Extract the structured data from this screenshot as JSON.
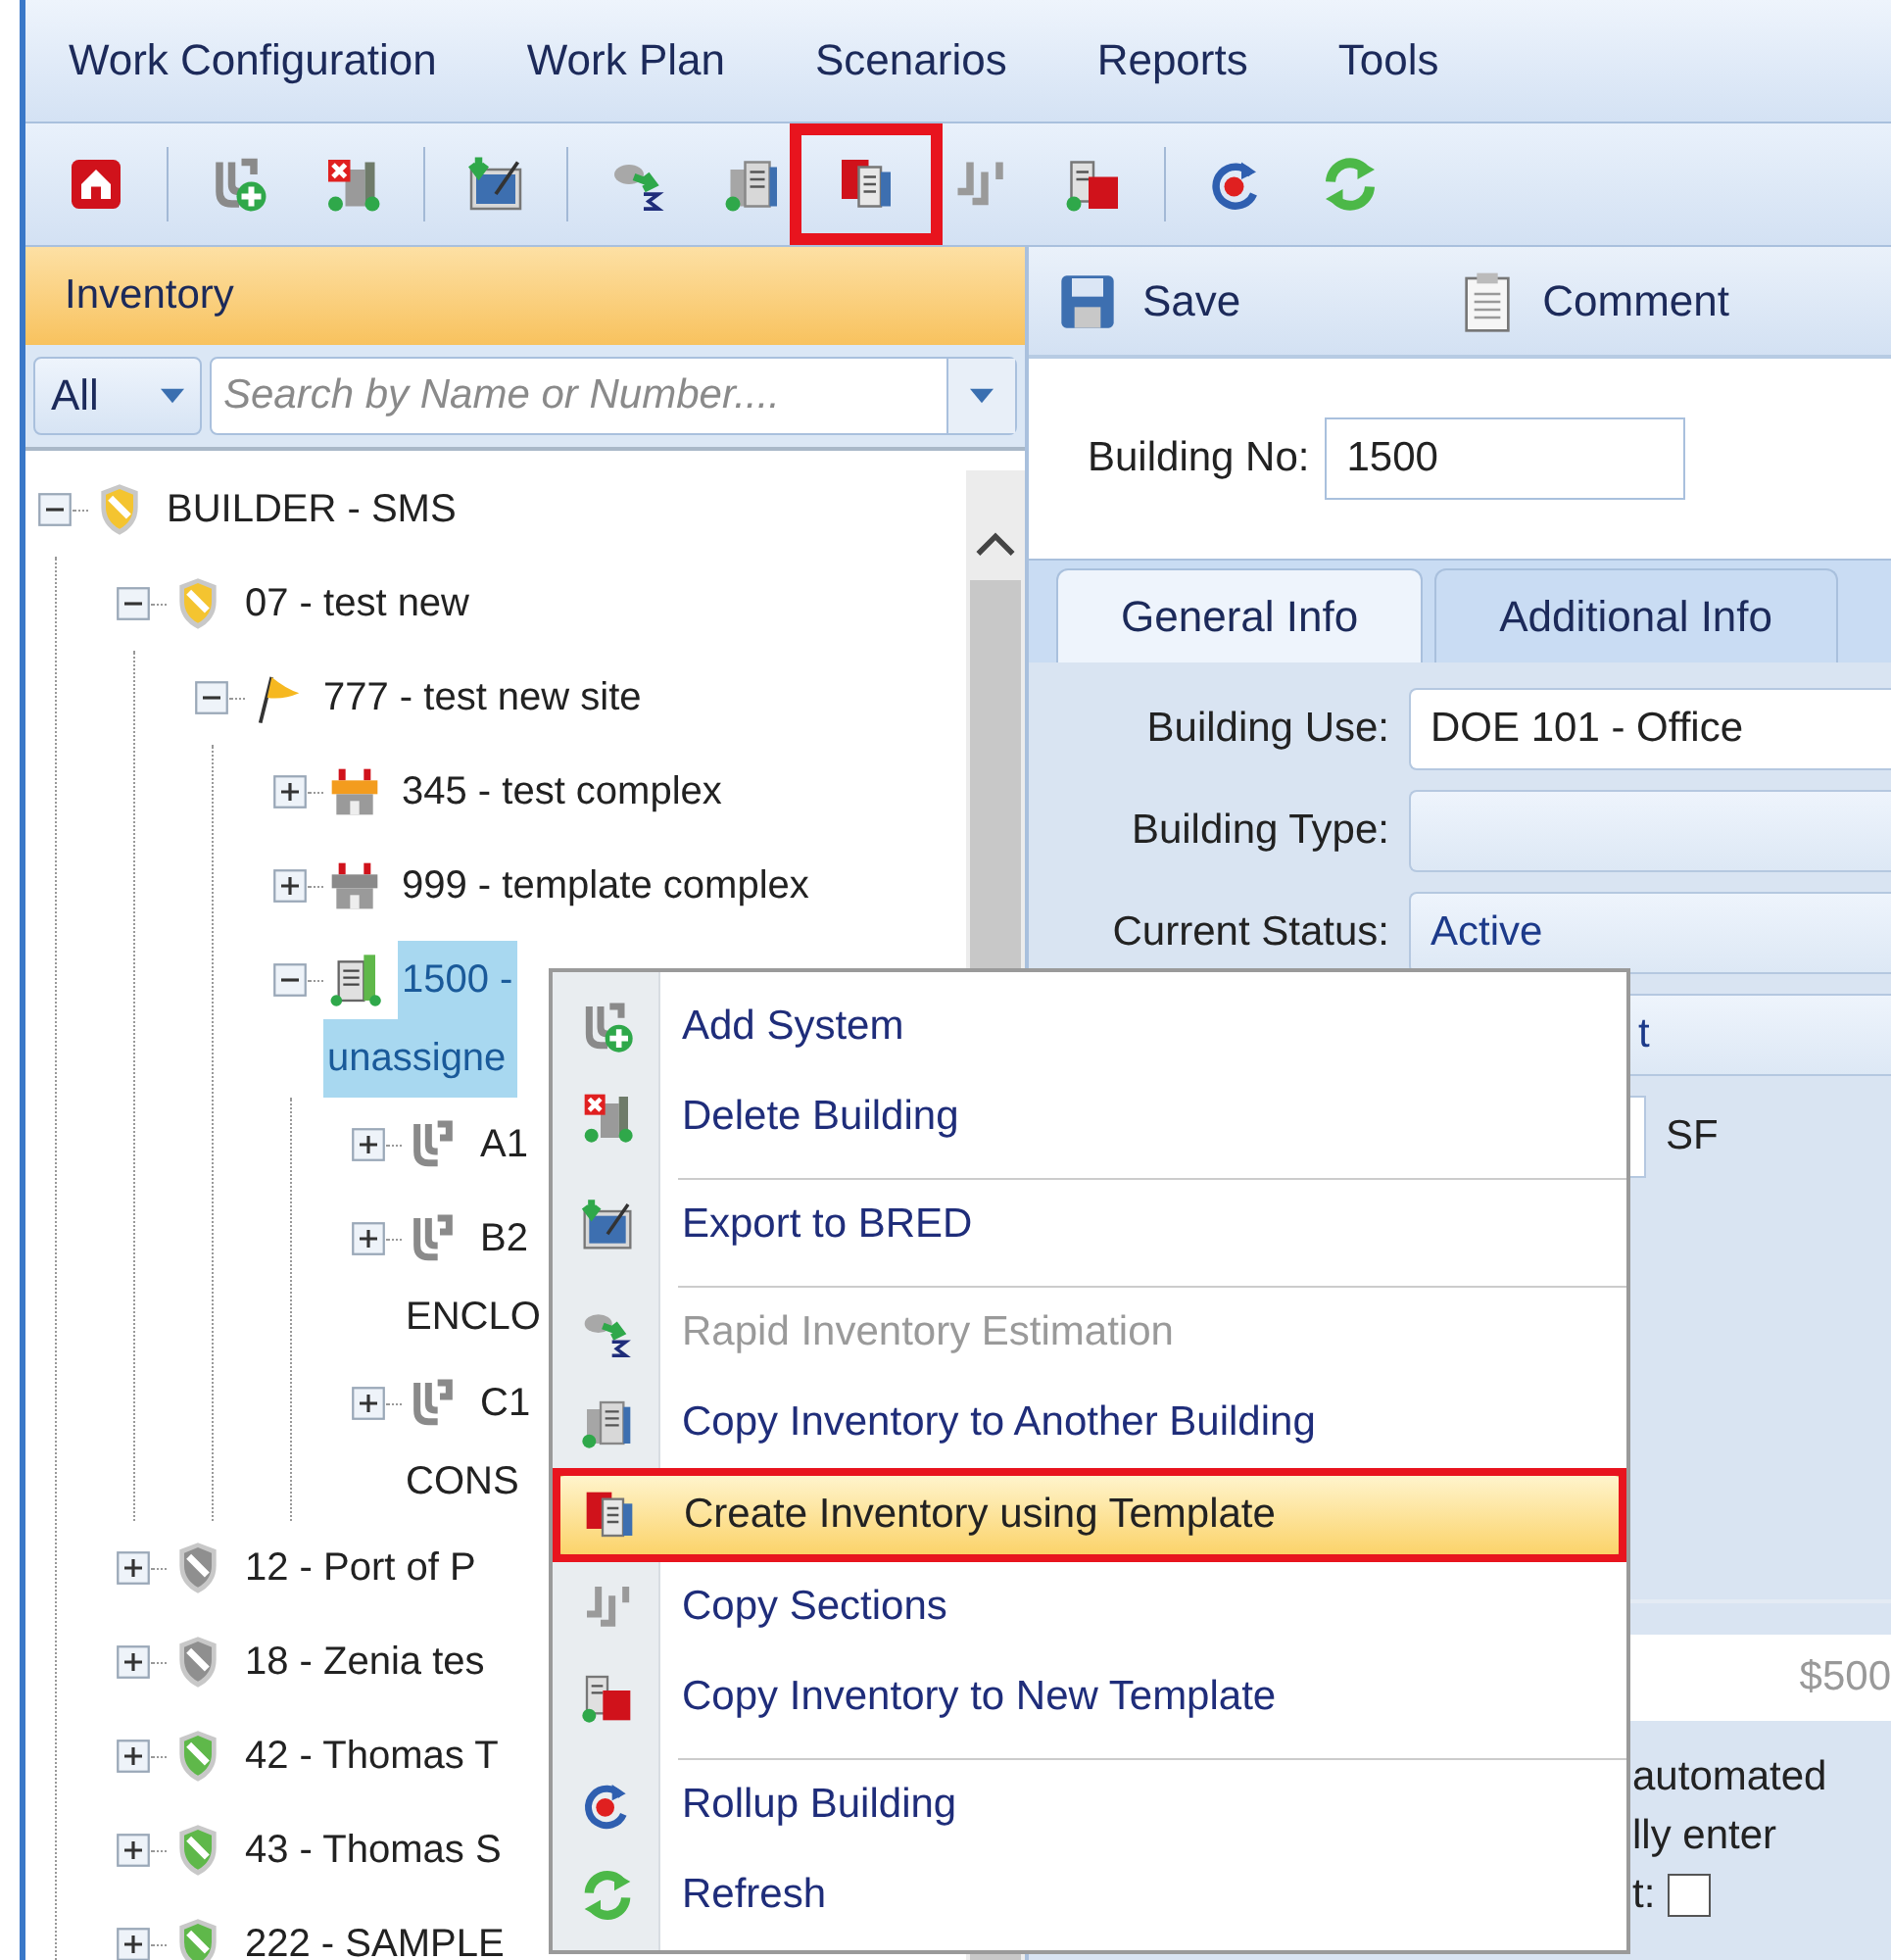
{
  "menu_bar": [
    {
      "label": "Work Configuration"
    },
    {
      "label": "Work Plan"
    },
    {
      "label": "Scenarios"
    },
    {
      "label": "Reports"
    },
    {
      "label": "Tools"
    }
  ],
  "toolbar": [
    {
      "kind": "home",
      "highlighted": false
    },
    {
      "kind": "separator"
    },
    {
      "kind": "system-add",
      "highlighted": false
    },
    {
      "kind": "building-delete",
      "highlighted": false
    },
    {
      "kind": "separator"
    },
    {
      "kind": "export",
      "highlighted": false
    },
    {
      "kind": "separator"
    },
    {
      "kind": "estimate",
      "highlighted": false
    },
    {
      "kind": "building-copy",
      "highlighted": false
    },
    {
      "kind": "template-create",
      "highlighted": true
    },
    {
      "kind": "sections-copy",
      "highlighted": false
    },
    {
      "kind": "template-copy",
      "highlighted": false
    },
    {
      "kind": "separator"
    },
    {
      "kind": "rollup",
      "highlighted": false
    },
    {
      "kind": "refresh",
      "highlighted": false
    }
  ],
  "inventory": {
    "title": "Inventory",
    "filter": "All",
    "search": {
      "placeholder": "Search by Name or Number...."
    },
    "tree": [
      {
        "kind": "shield-gold",
        "lines": [
          "BUILDER - SMS"
        ],
        "expanded": true,
        "selected": false,
        "children": [
          {
            "kind": "shield-gold",
            "lines": [
              "07 - test new"
            ],
            "expanded": true,
            "selected": false,
            "children": [
              {
                "kind": "flag",
                "lines": [
                  "777 - test new site"
                ],
                "expanded": true,
                "selected": false,
                "children": [
                  {
                    "kind": "complex-orange",
                    "lines": [
                      "345 - test complex"
                    ],
                    "expanded": false,
                    "selected": false
                  },
                  {
                    "kind": "complex-gray",
                    "lines": [
                      "999 - template complex"
                    ],
                    "expanded": false,
                    "selected": false
                  },
                  {
                    "kind": "building",
                    "lines": [
                      "1500 -",
                      "unassigne"
                    ],
                    "expanded": true,
                    "selected": true,
                    "children": [
                      {
                        "kind": "system",
                        "lines": [
                          "A1"
                        ],
                        "expanded": false,
                        "selected": false
                      },
                      {
                        "kind": "system",
                        "lines": [
                          "B2",
                          "ENCLO"
                        ],
                        "expanded": false,
                        "selected": false
                      },
                      {
                        "kind": "system",
                        "lines": [
                          "C1",
                          "CONS"
                        ],
                        "expanded": false,
                        "selected": false
                      }
                    ]
                  }
                ]
              }
            ]
          },
          {
            "kind": "shield-gray",
            "lines": [
              "12 - Port of P"
            ],
            "expanded": false,
            "selected": false
          },
          {
            "kind": "shield-gray",
            "lines": [
              "18 - Zenia tes"
            ],
            "expanded": false,
            "selected": false
          },
          {
            "kind": "shield-green",
            "lines": [
              "42 - Thomas T"
            ],
            "expanded": false,
            "selected": false
          },
          {
            "kind": "shield-green",
            "lines": [
              "43 - Thomas S"
            ],
            "expanded": false,
            "selected": false
          },
          {
            "kind": "shield-green",
            "lines": [
              "222 - SAMPLE"
            ],
            "expanded": false,
            "selected": false
          }
        ]
      }
    ]
  },
  "detail": {
    "actions": [
      {
        "kind": "save",
        "label": "Save"
      },
      {
        "kind": "comment",
        "label": "Comment"
      }
    ],
    "building_no": {
      "label": "Building No:",
      "value": "1500"
    },
    "tabs": [
      {
        "label": "General Info",
        "selected": true
      },
      {
        "label": "Additional Info",
        "selected": false
      }
    ],
    "fields": [
      {
        "label": "Building Use:",
        "value": "DOE 101 - Office",
        "kind": "text"
      },
      {
        "label": "Building Type:",
        "kind": "combo"
      },
      {
        "label": "Current Status:",
        "value": "Active",
        "kind": "combo"
      }
    ],
    "covered_value": "t",
    "unit": "SF",
    "cost": "$500",
    "notes": [
      "automated",
      "lly enter"
    ],
    "check_label": "t:",
    "checked": false
  },
  "context_menu": [
    {
      "kind": "item",
      "label": "Add System",
      "disabled": false,
      "selected": false,
      "highlighted": false
    },
    {
      "kind": "item",
      "label": "Delete Building",
      "disabled": false,
      "selected": false,
      "highlighted": false
    },
    {
      "kind": "separator"
    },
    {
      "kind": "item",
      "label": "Export to BRED",
      "disabled": false,
      "selected": false,
      "highlighted": false
    },
    {
      "kind": "separator"
    },
    {
      "kind": "item",
      "label": "Rapid Inventory Estimation",
      "disabled": true,
      "selected": false,
      "highlighted": false
    },
    {
      "kind": "item",
      "label": "Copy Inventory to Another Building",
      "disabled": false,
      "selected": false,
      "highlighted": false
    },
    {
      "kind": "item",
      "label": "Create Inventory using Template",
      "disabled": false,
      "selected": true,
      "highlighted": true
    },
    {
      "kind": "item",
      "label": "Copy Sections",
      "disabled": false,
      "selected": false,
      "highlighted": false
    },
    {
      "kind": "item",
      "label": "Copy Inventory to New Template",
      "disabled": false,
      "selected": false,
      "highlighted": false
    },
    {
      "kind": "separator"
    },
    {
      "kind": "item",
      "label": "Rollup Building",
      "disabled": false,
      "selected": false,
      "highlighted": false
    },
    {
      "kind": "item",
      "label": "Refresh",
      "disabled": false,
      "selected": false,
      "highlighted": false
    }
  ]
}
